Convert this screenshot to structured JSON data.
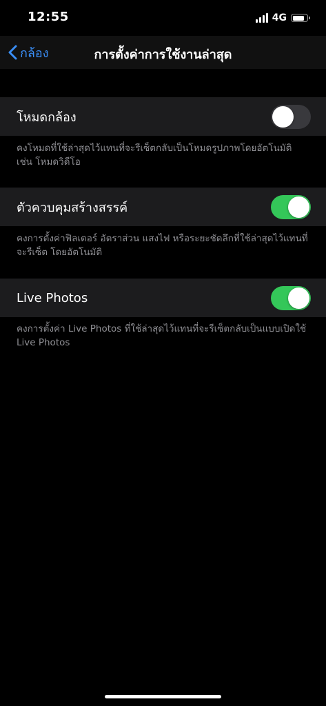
{
  "status_bar": {
    "time": "12:55",
    "network": "4G",
    "battery_level": 0.85,
    "signal_bars": 4
  },
  "nav": {
    "back_label": "กล้อง",
    "title": "การตั้งค่าการใช้งานล่าสุด"
  },
  "settings": [
    {
      "label": "โหมดกล้อง",
      "enabled": false,
      "footer": "คงโหมดที่ใช้ล่าสุดไว้แทนที่จะรีเซ็ตกลับเป็นโหมดรูปภาพโดยอัตโนมัติ เช่น โหมดวิดีโอ"
    },
    {
      "label": "ตัวควบคุมสร้างสรรค์",
      "enabled": true,
      "footer": "คงการตั้งค่าฟิลเตอร์ อัตราส่วน แสงไฟ หรือระยะชัดลึกที่ใช้ล่าสุดไว้แทนที่จะรีเซ็ต โดยอัตโนมัติ"
    },
    {
      "label": "Live Photos",
      "enabled": true,
      "footer": "คงการตั้งค่า Live Photos ที่ใช้ล่าสุดไว้แทนที่จะรีเซ็ตกลับเป็นแบบเปิดใช้ Live Photos"
    }
  ],
  "colors": {
    "accent": "#3a8ef6",
    "toggle_on": "#34c759",
    "toggle_off": "#39393d",
    "cell_background": "#1c1c1e",
    "footer_text": "#8e8e93"
  }
}
